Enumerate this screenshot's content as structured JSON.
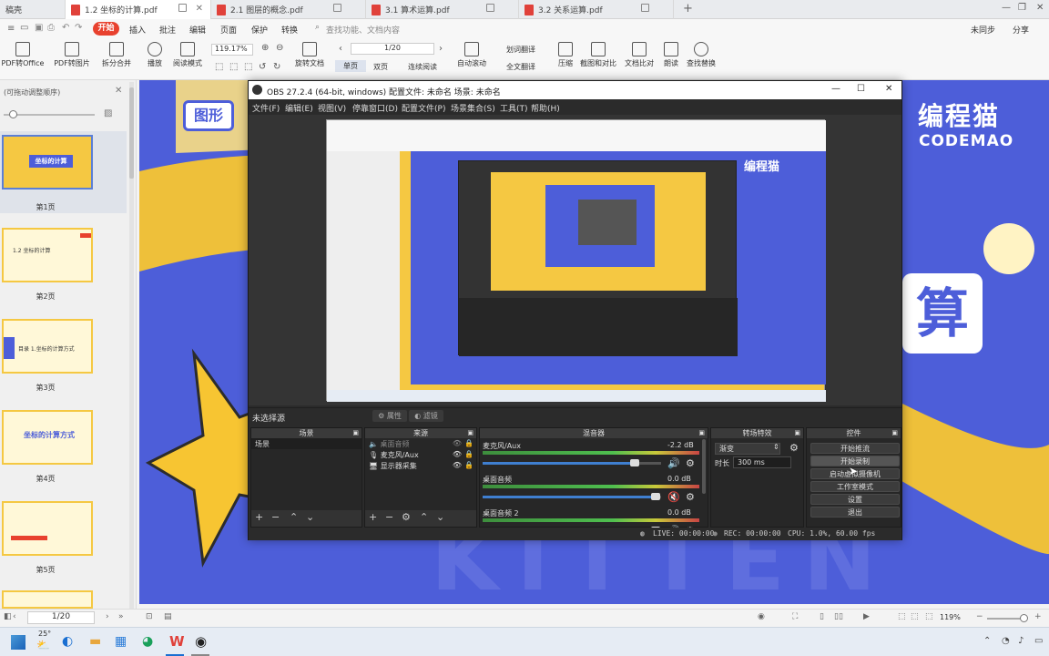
{
  "tabs": [
    {
      "label": "稿壳"
    },
    {
      "label": "1.2 坐标的计算.pdf"
    },
    {
      "label": "2.1 图层的概念.pdf"
    },
    {
      "label": "3.1 算术运算.pdf"
    },
    {
      "label": "3.2 关系运算.pdf"
    }
  ],
  "menu": {
    "items": [
      "开始",
      "插入",
      "批注",
      "编辑",
      "页面",
      "保护",
      "转换"
    ],
    "search_placeholder": "查找功能、文档内容",
    "right": [
      "未同步",
      "分享"
    ]
  },
  "toolbar": {
    "zoom": "119.17%",
    "page_indicator": "1/20",
    "tools": [
      "PDF转Office",
      "PDF转图片",
      "拆分合并",
      "播放",
      "阅读模式",
      "旋转文档",
      "单页",
      "双页",
      "连续阅读",
      "自动滚动",
      "全文翻译",
      "划词翻译",
      "压缩",
      "截图和对比",
      "文档比对",
      "朗读",
      "查找替换"
    ]
  },
  "leftpanel": {
    "title": "(可拖动调整顺序)",
    "thumbs": [
      {
        "caption": "第1页",
        "text": "坐标的计算"
      },
      {
        "caption": "第2页",
        "text": "1.2 坐标的计算"
      },
      {
        "caption": "第3页",
        "text": "目录 1.坐标的计算方式"
      },
      {
        "caption": "第4页",
        "text": "坐标的计算方式"
      },
      {
        "caption": "第5页",
        "text": ""
      }
    ]
  },
  "slide": {
    "brand_cn": "编程猫",
    "brand_en": "CODEMAO",
    "banner": "图形",
    "big_char": "算",
    "watermark": "KITTEN"
  },
  "obs": {
    "title": "OBS 27.2.4 (64-bit, windows)  配置文件: 未命名  场景: 未命名",
    "menu": [
      "文件(F)",
      "编辑(E)",
      "视图(V)",
      "停靠窗口(D)",
      "配置文件(P)",
      "场景集合(S)",
      "工具(T)",
      "帮助(H)"
    ],
    "no_source": "未选择源",
    "properties": "属性",
    "filters": "滤镜",
    "docks": {
      "scenes": {
        "title": "场景",
        "items": [
          "场景"
        ]
      },
      "sources": {
        "title": "来源",
        "items": [
          "桌面音频",
          "麦克风/Aux",
          "显示器采集"
        ]
      },
      "mixer": {
        "title": "混音器",
        "channels": [
          {
            "name": "麦克风/Aux",
            "db": "-2.2 dB",
            "level": 0.85,
            "muted": false
          },
          {
            "name": "桌面音频",
            "db": "0.0 dB",
            "level": 0.97,
            "muted": true
          },
          {
            "name": "桌面音频 2",
            "db": "0.0 dB",
            "level": 0.97,
            "muted": false
          }
        ]
      },
      "transitions": {
        "title": "转场特效",
        "type": "渐变",
        "duration_label": "时长",
        "duration": "300 ms"
      },
      "controls": {
        "title": "控件",
        "buttons": [
          "开始推流",
          "开始录制",
          "启动虚拟摄像机",
          "工作室模式",
          "设置",
          "退出"
        ]
      }
    },
    "status": {
      "live": "LIVE: 00:00:00",
      "rec": "REC: 00:00:00",
      "cpu": "CPU: 1.0%, 60.00 fps"
    }
  },
  "statusbar": {
    "page": "1/20",
    "zoom": "119%"
  },
  "taskbar": {
    "temp": "25°"
  },
  "colors": {
    "wps_red": "#e8412e",
    "slide_blue": "#4d5ed9",
    "slide_yellow": "#f7c532",
    "obs_bg": "#2b2b2b"
  }
}
